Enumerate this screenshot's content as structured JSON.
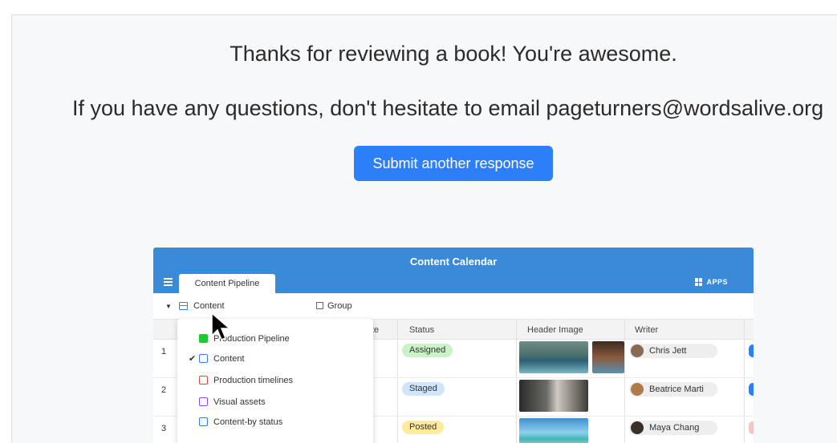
{
  "confirmation": {
    "thanks": "Thanks for reviewing a book! You're awesome.",
    "contact": "If you have any questions, don't hesitate to email pageturners@wordsalive.org",
    "submit_label": "Submit another response"
  },
  "embedded_app": {
    "base_title": "Content Calendar",
    "active_tab": "Content Pipeline",
    "apps_label": "APPS",
    "current_view": "Content",
    "group_label": "Group",
    "columns": [
      "te",
      "Status",
      "Header Image",
      "Writer"
    ],
    "rows": [
      {
        "num": "1",
        "status": "Assigned",
        "writer": "Chris Jett"
      },
      {
        "num": "2",
        "status": "Staged",
        "writer": "Beatrice Marti"
      },
      {
        "num": "3",
        "status": "Posted",
        "writer": "Maya Chang"
      }
    ],
    "views_menu": [
      {
        "label": "Production Pipeline",
        "icon": "kanban-icon"
      },
      {
        "label": "Content",
        "icon": "grid-icon",
        "checked": true
      },
      {
        "label": "Production timelines",
        "icon": "form-icon"
      },
      {
        "label": "Visual assets",
        "icon": "gallery-icon"
      },
      {
        "label": "Content-by status",
        "icon": "grid-icon"
      }
    ]
  },
  "colors": {
    "accent": "#2d7ff9",
    "header_blue": "#3a8ad9",
    "assigned": "#c9f2c6",
    "staged": "#cfe5fb",
    "posted": "#ffeaa0"
  }
}
